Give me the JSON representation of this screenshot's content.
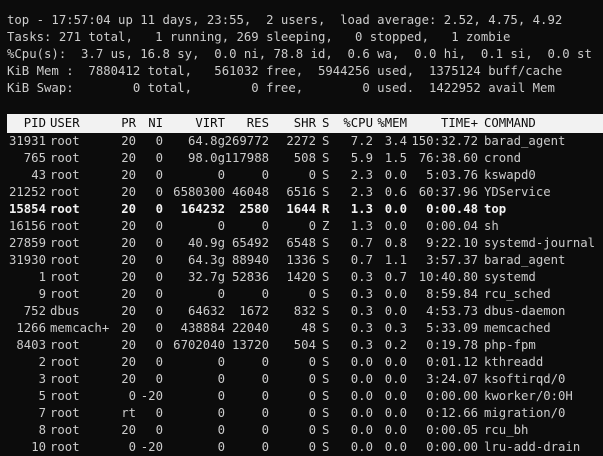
{
  "summary": [
    "top - 17:57:04 up 11 days, 23:55,  2 users,  load average: 2.52, 4.75, 4.92",
    "Tasks: 271 total,   1 running, 269 sleeping,   0 stopped,   1 zombie",
    "%Cpu(s):  3.7 us, 16.8 sy,  0.0 ni, 78.8 id,  0.6 wa,  0.0 hi,  0.1 si,  0.0 st",
    "KiB Mem :  7880412 total,   561032 free,  5944256 used,  1375124 buff/cache",
    "KiB Swap:        0 total,        0 free,        0 used.  1422952 avail Mem"
  ],
  "header": {
    "pid": "PID",
    "user": "USER",
    "pr": "PR",
    "ni": "NI",
    "virt": "VIRT",
    "res": "RES",
    "shr": "SHR",
    "s": "S",
    "cpu": "%CPU",
    "mem": "%MEM",
    "time": "TIME+",
    "command": "COMMAND"
  },
  "processes": [
    {
      "pid": "31931",
      "user": "root",
      "pr": "20",
      "ni": "0",
      "virt": "64.8g",
      "res": "269772",
      "shr": "2272",
      "s": "S",
      "cpu": "7.2",
      "mem": "3.4",
      "time": "150:32.72",
      "command": "barad_agent"
    },
    {
      "pid": "765",
      "user": "root",
      "pr": "20",
      "ni": "0",
      "virt": "98.0g",
      "res": "117988",
      "shr": "508",
      "s": "S",
      "cpu": "5.9",
      "mem": "1.5",
      "time": "76:38.60",
      "command": "crond"
    },
    {
      "pid": "43",
      "user": "root",
      "pr": "20",
      "ni": "0",
      "virt": "0",
      "res": "0",
      "shr": "0",
      "s": "S",
      "cpu": "2.3",
      "mem": "0.0",
      "time": "5:03.76",
      "command": "kswapd0"
    },
    {
      "pid": "21252",
      "user": "root",
      "pr": "20",
      "ni": "0",
      "virt": "6580300",
      "res": "46048",
      "shr": "6516",
      "s": "S",
      "cpu": "2.3",
      "mem": "0.6",
      "time": "60:37.96",
      "command": "YDService"
    },
    {
      "pid": "15854",
      "user": "root",
      "pr": "20",
      "ni": "0",
      "virt": "164232",
      "res": "2580",
      "shr": "1644",
      "s": "R",
      "cpu": "1.3",
      "mem": "0.0",
      "time": "0:00.48",
      "command": "top",
      "bold": true
    },
    {
      "pid": "16156",
      "user": "root",
      "pr": "20",
      "ni": "0",
      "virt": "0",
      "res": "0",
      "shr": "0",
      "s": "Z",
      "cpu": "1.3",
      "mem": "0.0",
      "time": "0:00.04",
      "command": "sh"
    },
    {
      "pid": "27859",
      "user": "root",
      "pr": "20",
      "ni": "0",
      "virt": "40.9g",
      "res": "65492",
      "shr": "6548",
      "s": "S",
      "cpu": "0.7",
      "mem": "0.8",
      "time": "9:22.10",
      "command": "systemd-journal"
    },
    {
      "pid": "31930",
      "user": "root",
      "pr": "20",
      "ni": "0",
      "virt": "64.3g",
      "res": "88940",
      "shr": "1336",
      "s": "S",
      "cpu": "0.7",
      "mem": "1.1",
      "time": "3:57.37",
      "command": "barad_agent"
    },
    {
      "pid": "1",
      "user": "root",
      "pr": "20",
      "ni": "0",
      "virt": "32.7g",
      "res": "52836",
      "shr": "1420",
      "s": "S",
      "cpu": "0.3",
      "mem": "0.7",
      "time": "10:40.80",
      "command": "systemd"
    },
    {
      "pid": "9",
      "user": "root",
      "pr": "20",
      "ni": "0",
      "virt": "0",
      "res": "0",
      "shr": "0",
      "s": "S",
      "cpu": "0.3",
      "mem": "0.0",
      "time": "8:59.84",
      "command": "rcu_sched"
    },
    {
      "pid": "752",
      "user": "dbus",
      "pr": "20",
      "ni": "0",
      "virt": "64632",
      "res": "1672",
      "shr": "832",
      "s": "S",
      "cpu": "0.3",
      "mem": "0.0",
      "time": "4:53.73",
      "command": "dbus-daemon"
    },
    {
      "pid": "1266",
      "user": "memcach+",
      "pr": "20",
      "ni": "0",
      "virt": "438884",
      "res": "22040",
      "shr": "48",
      "s": "S",
      "cpu": "0.3",
      "mem": "0.3",
      "time": "5:33.09",
      "command": "memcached"
    },
    {
      "pid": "8403",
      "user": "root",
      "pr": "20",
      "ni": "0",
      "virt": "6702040",
      "res": "13720",
      "shr": "504",
      "s": "S",
      "cpu": "0.3",
      "mem": "0.2",
      "time": "0:19.78",
      "command": "php-fpm"
    },
    {
      "pid": "2",
      "user": "root",
      "pr": "20",
      "ni": "0",
      "virt": "0",
      "res": "0",
      "shr": "0",
      "s": "S",
      "cpu": "0.0",
      "mem": "0.0",
      "time": "0:01.12",
      "command": "kthreadd"
    },
    {
      "pid": "3",
      "user": "root",
      "pr": "20",
      "ni": "0",
      "virt": "0",
      "res": "0",
      "shr": "0",
      "s": "S",
      "cpu": "0.0",
      "mem": "0.0",
      "time": "3:24.07",
      "command": "ksoftirqd/0"
    },
    {
      "pid": "5",
      "user": "root",
      "pr": "0",
      "ni": "-20",
      "virt": "0",
      "res": "0",
      "shr": "0",
      "s": "S",
      "cpu": "0.0",
      "mem": "0.0",
      "time": "0:00.00",
      "command": "kworker/0:0H"
    },
    {
      "pid": "7",
      "user": "root",
      "pr": "rt",
      "ni": "0",
      "virt": "0",
      "res": "0",
      "shr": "0",
      "s": "S",
      "cpu": "0.0",
      "mem": "0.0",
      "time": "0:12.66",
      "command": "migration/0"
    },
    {
      "pid": "8",
      "user": "root",
      "pr": "20",
      "ni": "0",
      "virt": "0",
      "res": "0",
      "shr": "0",
      "s": "S",
      "cpu": "0.0",
      "mem": "0.0",
      "time": "0:00.05",
      "command": "rcu_bh"
    },
    {
      "pid": "10",
      "user": "root",
      "pr": "0",
      "ni": "-20",
      "virt": "0",
      "res": "0",
      "shr": "0",
      "s": "S",
      "cpu": "0.0",
      "mem": "0.0",
      "time": "0:00.00",
      "command": "lru-add-drain"
    }
  ]
}
